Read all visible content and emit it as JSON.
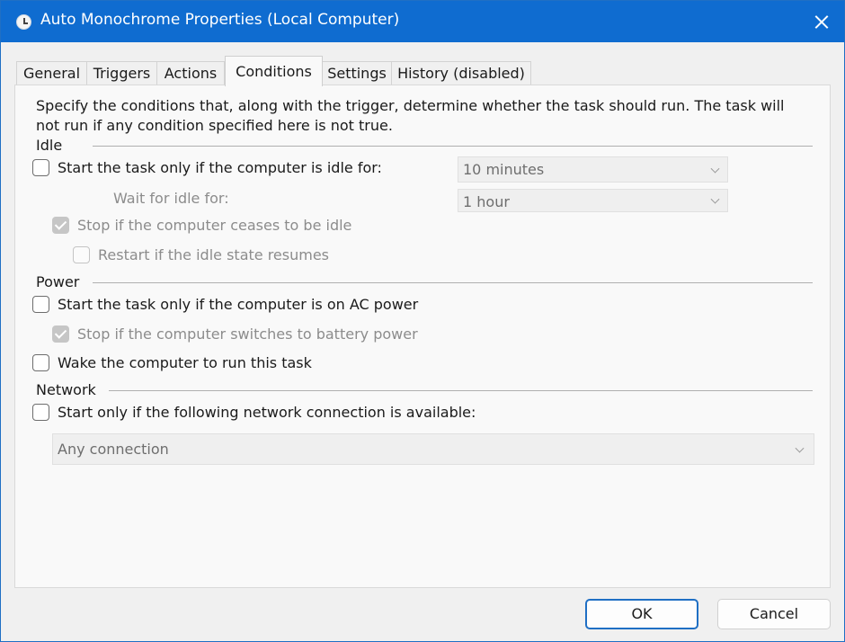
{
  "window": {
    "title": "Auto Monochrome Properties (Local Computer)"
  },
  "tabs": [
    {
      "label": "General"
    },
    {
      "label": "Triggers"
    },
    {
      "label": "Actions"
    },
    {
      "label": "Conditions",
      "active": true
    },
    {
      "label": "Settings"
    },
    {
      "label": "History (disabled)"
    }
  ],
  "description": "Specify the conditions that, along with the trigger, determine whether the task should run.  The task will not run  if any condition specified here is not true.",
  "idle": {
    "group_label": "Idle",
    "start_if_idle": {
      "label": "Start the task only if the computer is idle for:",
      "checked": false
    },
    "idle_for": {
      "value": "10 minutes"
    },
    "wait_for_idle": {
      "label": "Wait for idle for:",
      "value": "1 hour"
    },
    "stop_if_ceases": {
      "label": "Stop if the computer ceases to be idle",
      "checked": true,
      "enabled": false
    },
    "restart_if_resumes": {
      "label": "Restart if the idle state resumes",
      "checked": false,
      "enabled": false
    }
  },
  "power": {
    "group_label": "Power",
    "ac_power": {
      "label": "Start the task only if the computer is on AC power",
      "checked": false
    },
    "battery": {
      "label": "Stop if the computer switches to battery power",
      "checked": true,
      "enabled": false
    },
    "wake": {
      "label": "Wake the computer to run this task",
      "checked": false
    }
  },
  "network": {
    "group_label": "Network",
    "start_if_available": {
      "label": "Start only if the following network connection is available:",
      "checked": false
    },
    "connection": {
      "value": "Any connection"
    }
  },
  "buttons": {
    "ok": "OK",
    "cancel": "Cancel"
  },
  "colors": {
    "titlebar": "#0f6cd0",
    "accent": "#1f6fc4",
    "panel": "#f9f9f9"
  }
}
